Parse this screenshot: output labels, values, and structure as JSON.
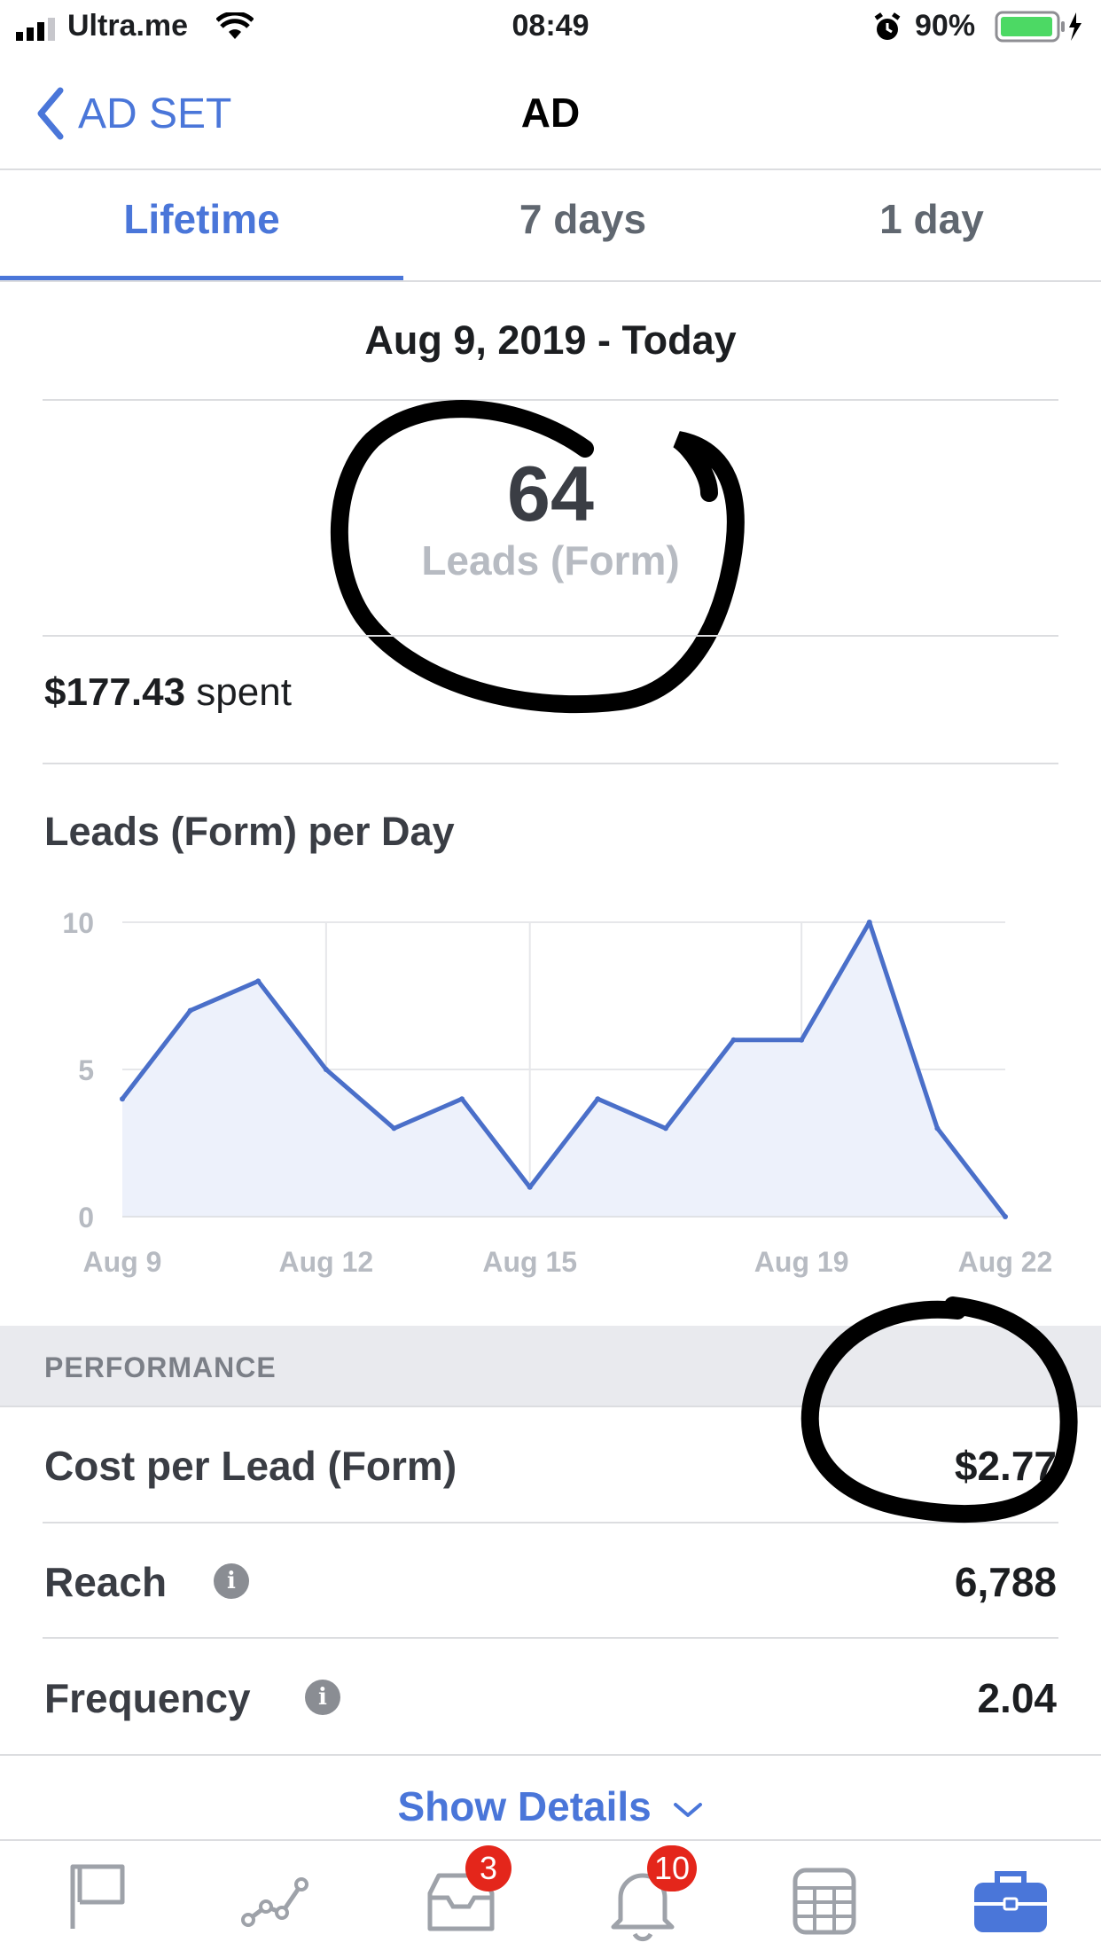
{
  "status_bar": {
    "carrier": "Ultra.me",
    "time": "08:49",
    "battery": "90%"
  },
  "nav": {
    "back_label": "AD SET",
    "title": "AD"
  },
  "tabs": [
    {
      "label": "Lifetime",
      "active": true
    },
    {
      "label": "7 days",
      "active": false
    },
    {
      "label": "1 day",
      "active": false
    }
  ],
  "date_range": {
    "start": "Aug 9, 2019 - ",
    "end": "Today"
  },
  "summary": {
    "value": "64",
    "label": "Leads (Form)",
    "spent_amount": "$177.43",
    "spent_suffix": " spent"
  },
  "chart_data": {
    "type": "area",
    "title": "Leads (Form) per Day",
    "x": [
      "Aug 9",
      "Aug 10",
      "Aug 11",
      "Aug 12",
      "Aug 13",
      "Aug 14",
      "Aug 15",
      "Aug 16",
      "Aug 17",
      "Aug 18",
      "Aug 19",
      "Aug 20",
      "Aug 21",
      "Aug 22"
    ],
    "values": [
      4,
      7,
      8,
      5,
      3,
      4,
      1,
      4,
      3,
      6,
      6,
      10,
      3,
      0
    ],
    "x_tick_labels": [
      "Aug 9",
      "Aug 12",
      "Aug 15",
      "Aug 19",
      "Aug 22"
    ],
    "y_tick_labels": [
      "10",
      "5",
      "0"
    ],
    "ylim": [
      0,
      10
    ],
    "colors": {
      "line": "#4a6fc9",
      "fill": "#edf1fb"
    }
  },
  "performance": {
    "header": "PERFORMANCE",
    "rows": [
      {
        "label": "Cost per Lead (Form)",
        "value": "$2.77"
      },
      {
        "label": "Reach",
        "value": "6,788"
      },
      {
        "label": "Frequency",
        "value": "2.04"
      }
    ]
  },
  "show_details": "Show Details",
  "tab_bar": {
    "items": [
      {
        "icon": "flag-icon"
      },
      {
        "icon": "graph-icon"
      },
      {
        "icon": "inbox-icon",
        "badge": "3"
      },
      {
        "icon": "bell-icon",
        "badge": "10"
      },
      {
        "icon": "calendar-icon"
      },
      {
        "icon": "briefcase-icon",
        "active": true
      }
    ]
  },
  "colors": {
    "accent": "#4a76d9",
    "badge": "#e4261b"
  }
}
